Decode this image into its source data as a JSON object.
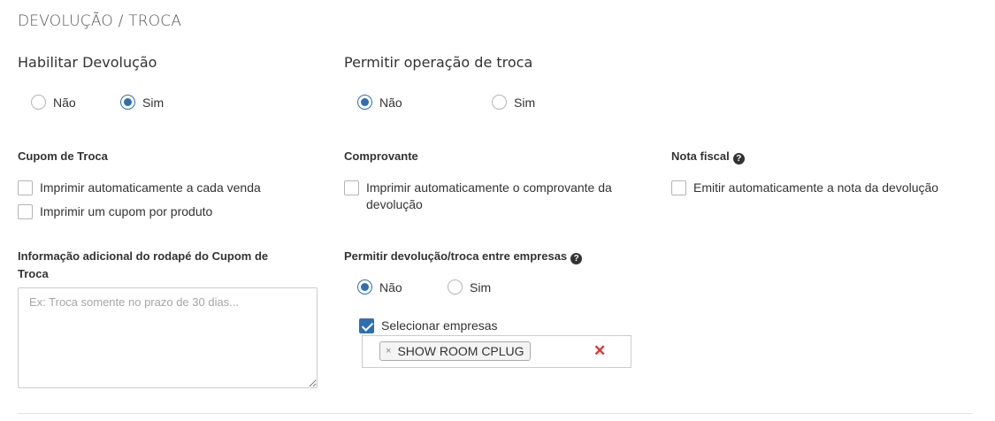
{
  "section_title": "DEVOLUÇÃO / TROCA",
  "habilitar_devolucao": {
    "label": "Habilitar Devolução",
    "options": [
      "Não",
      "Sim"
    ],
    "selected": "Sim"
  },
  "permitir_troca": {
    "label": "Permitir operação de troca",
    "options": [
      "Não",
      "Sim"
    ],
    "selected": "Não"
  },
  "cupom_troca": {
    "label": "Cupom de Troca",
    "checkboxes": [
      {
        "label": "Imprimir automaticamente a cada venda",
        "checked": false
      },
      {
        "label": "Imprimir um cupom por produto",
        "checked": false
      }
    ]
  },
  "comprovante": {
    "label": "Comprovante",
    "checkboxes": [
      {
        "label": "Imprimir automaticamente o comprovante da devolução",
        "checked": false
      }
    ]
  },
  "nota_fiscal": {
    "label": "Nota fiscal",
    "checkboxes": [
      {
        "label": "Emitir automaticamente a nota da devolução",
        "checked": false
      }
    ]
  },
  "rodape": {
    "label": "Informação adicional do rodapé do Cupom de Troca",
    "placeholder": "Ex: Troca somente no prazo de 30 dias...",
    "value": ""
  },
  "entre_empresas": {
    "label": "Permitir devolução/troca entre empresas",
    "options": [
      "Não",
      "Sim"
    ],
    "selected": "Não",
    "selecionar_label": "Selecionar empresas",
    "selecionar_checked": true,
    "selected_tags": [
      "SHOW ROOM CPLUG"
    ],
    "tag_remove_glyph": "×",
    "clear_glyph": "✕"
  },
  "colors": {
    "accent": "#2f6fb1",
    "clear": "#e03535"
  }
}
